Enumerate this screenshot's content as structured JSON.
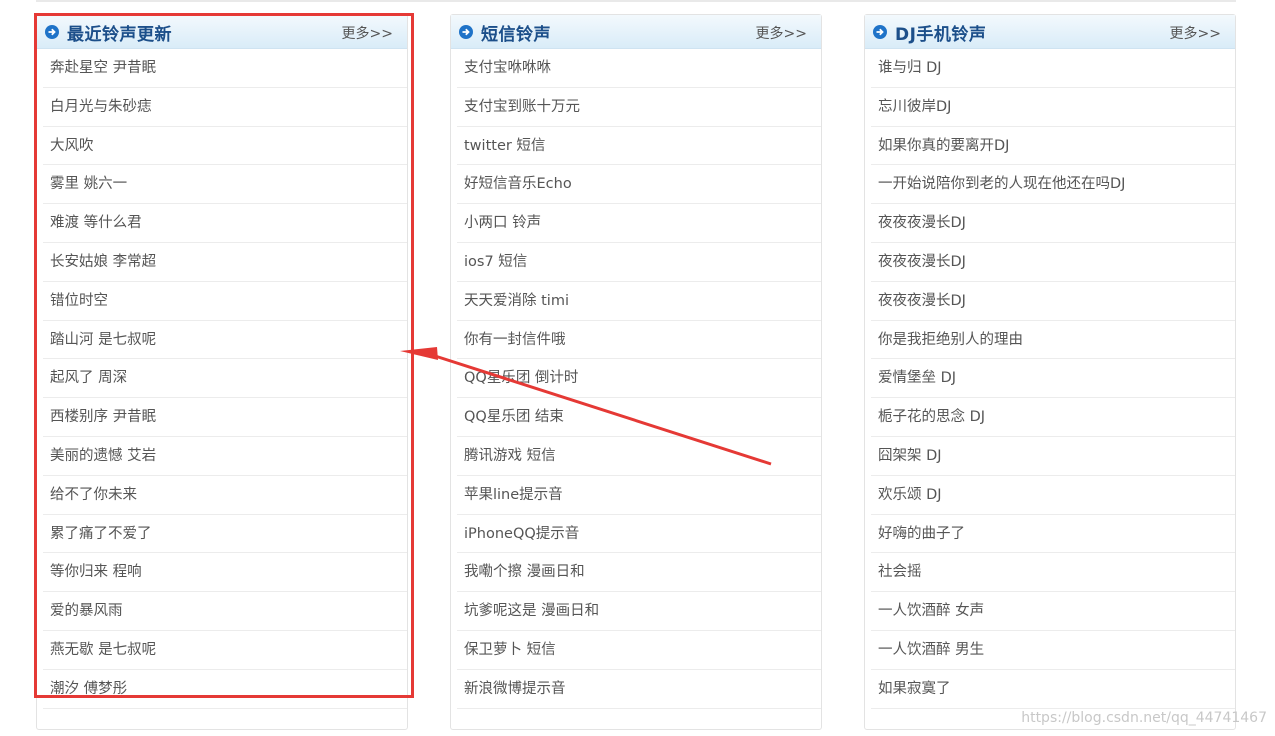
{
  "panels": [
    {
      "title": "最近铃声更新",
      "more": "更多>>",
      "items": [
        "奔赴星空 尹昔眠",
        "白月光与朱砂痣",
        "大风吹",
        "雾里 姚六一",
        "难渡 等什么君",
        "长安姑娘 李常超",
        "错位时空",
        "踏山河 是七叔呢",
        "起风了 周深",
        "西楼别序 尹昔眠",
        "美丽的遗憾 艾岩",
        "给不了你未来",
        "累了痛了不爱了",
        "等你归来 程响",
        "爱的暴风雨",
        "燕无歇 是七叔呢",
        "潮汐 傅梦彤"
      ]
    },
    {
      "title": "短信铃声",
      "more": "更多>>",
      "items": [
        "支付宝咻咻咻",
        "支付宝到账十万元",
        "twitter 短信",
        "好短信音乐Echo",
        "小两口 铃声",
        "ios7 短信",
        "天天爱消除 timi",
        "你有一封信件哦",
        "QQ星乐团 倒计时",
        "QQ星乐团 结束",
        "腾讯游戏 短信",
        "苹果line提示音",
        "iPhoneQQ提示音",
        "我嘞个擦 漫画日和",
        "坑爹呢这是 漫画日和",
        "保卫萝卜 短信",
        "新浪微博提示音"
      ]
    },
    {
      "title": "DJ手机铃声",
      "more": "更多>>",
      "items": [
        "谁与归 DJ",
        "忘川彼岸DJ",
        "如果你真的要离开DJ",
        "一开始说陪你到老的人现在他还在吗DJ",
        "夜夜夜漫长DJ",
        "夜夜夜漫长DJ",
        "夜夜夜漫长DJ",
        "你是我拒绝别人的理由",
        "爱情堡垒 DJ",
        "栀子花的思念 DJ",
        "囧架架 DJ",
        "欢乐颂 DJ",
        "好嗨的曲子了",
        "社会摇",
        "一人饮酒醉 女声",
        "一人饮酒醉 男生",
        "如果寂寞了"
      ]
    }
  ],
  "watermark": "https://blog.csdn.net/qq_44741467",
  "colors": {
    "accent": "#1c4f8a",
    "annotation": "#e53935",
    "header_bg": "#d9ecf8"
  }
}
